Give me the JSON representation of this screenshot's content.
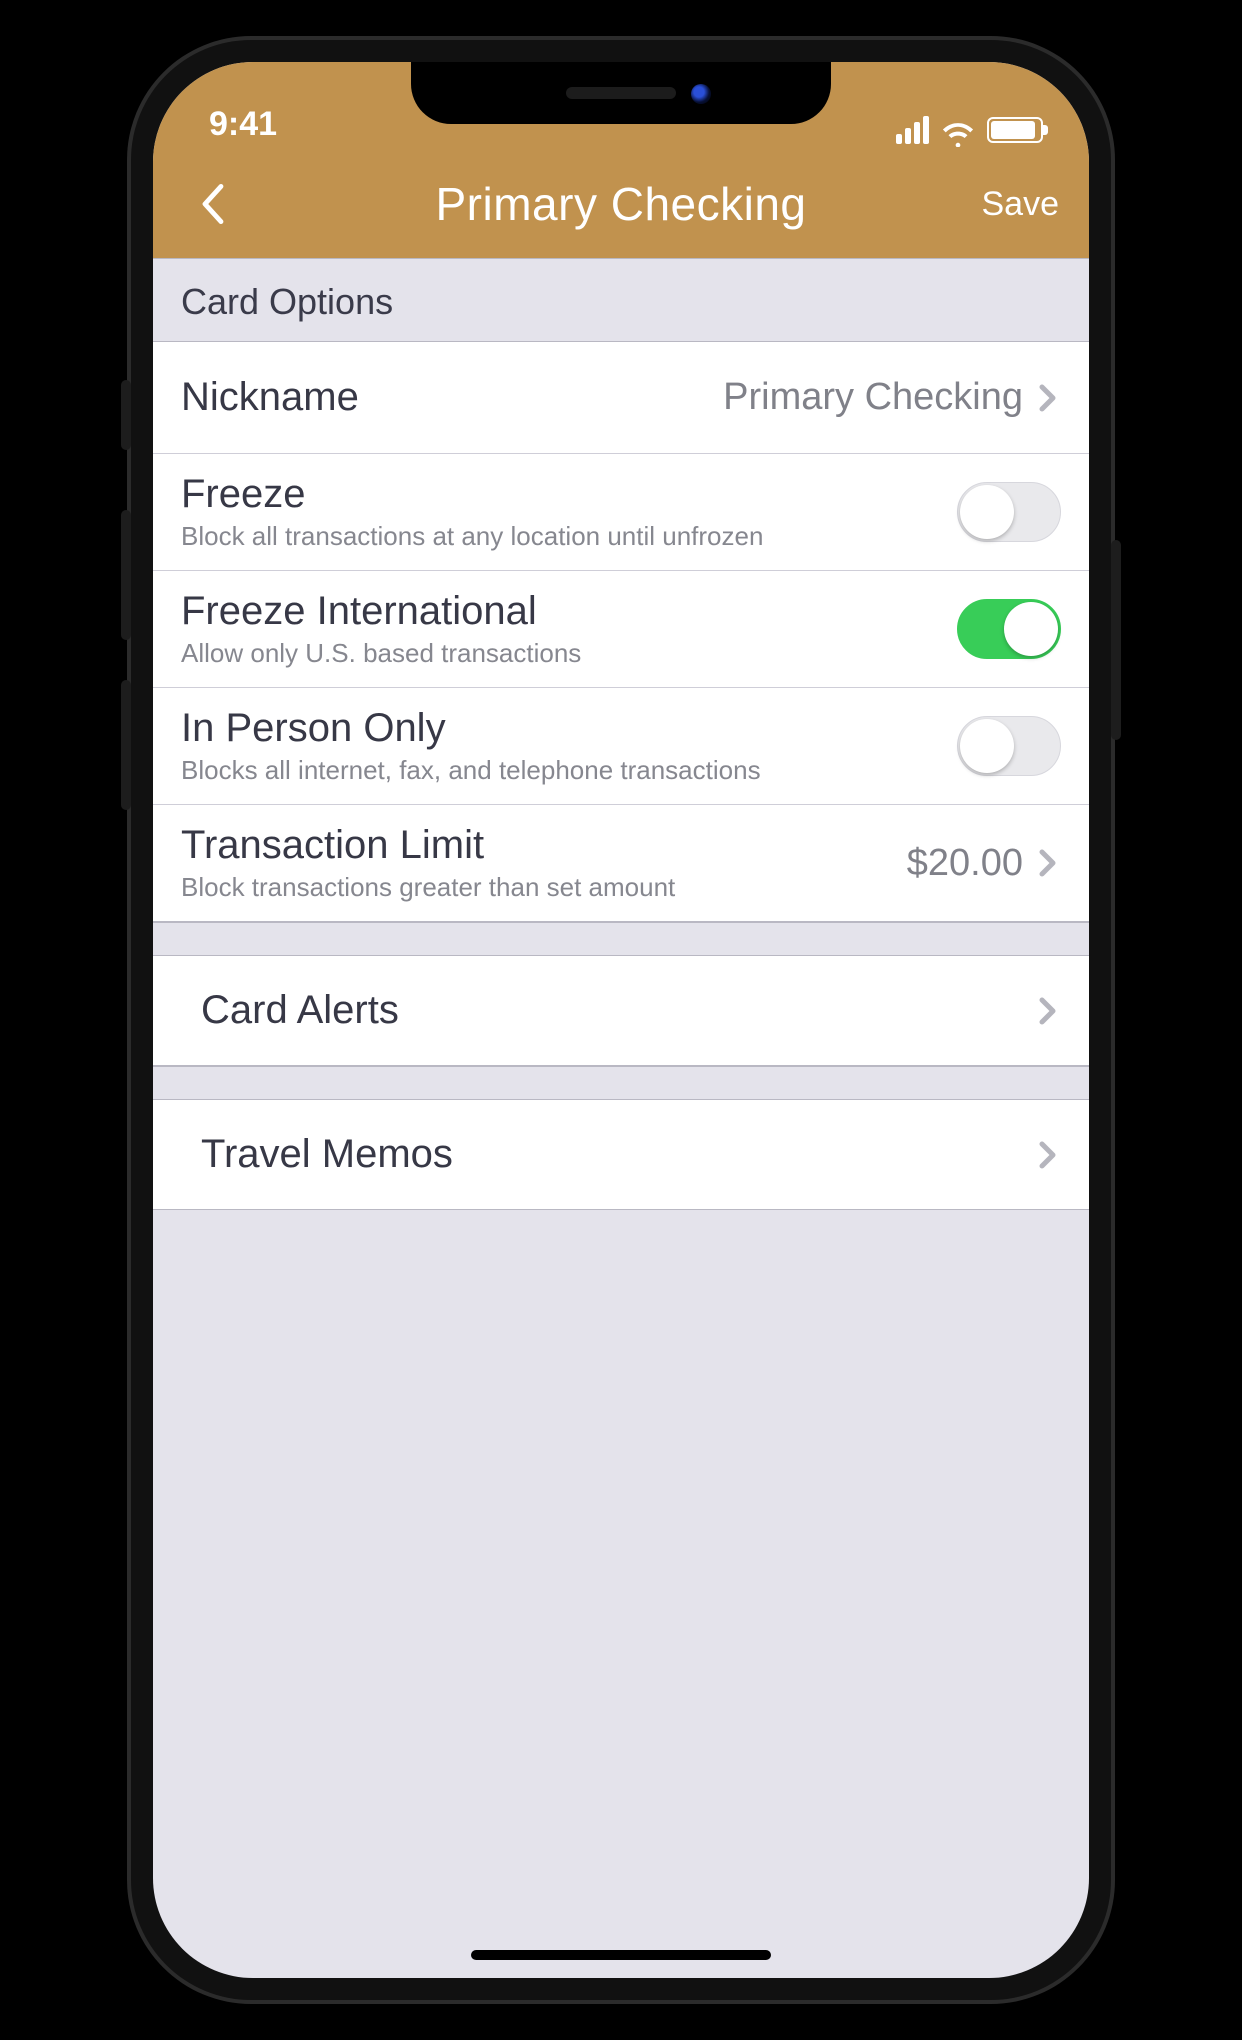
{
  "status": {
    "time": "9:41"
  },
  "nav": {
    "title": "Primary Checking",
    "save": "Save"
  },
  "section": {
    "card_options": "Card Options"
  },
  "rows": {
    "nickname": {
      "label": "Nickname",
      "value": "Primary Checking"
    },
    "freeze": {
      "label": "Freeze",
      "sub": "Block all transactions at any location until unfrozen",
      "on": false
    },
    "freeze_intl": {
      "label": "Freeze International",
      "sub": "Allow only U.S. based transactions",
      "on": true
    },
    "in_person": {
      "label": "In Person Only",
      "sub": "Blocks all internet, fax, and telephone transactions",
      "on": false
    },
    "tx_limit": {
      "label": "Transaction Limit",
      "sub": "Block transactions greater than set amount",
      "value": "$20.00"
    }
  },
  "links": {
    "card_alerts": "Card Alerts",
    "travel_memos": "Travel Memos"
  }
}
